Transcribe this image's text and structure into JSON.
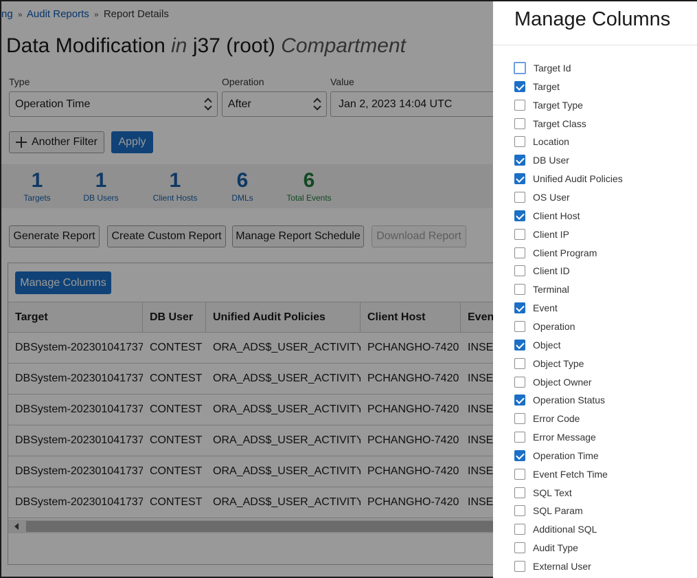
{
  "breadcrumb": {
    "items": [
      "ng",
      "Audit Reports",
      "Report Details"
    ],
    "separator": "»"
  },
  "title": {
    "main": "Data Modification",
    "in": "in",
    "compartment_name": "j37 (root)",
    "compartment_word": "Compartment"
  },
  "filters": {
    "type_label": "Type",
    "type_value": "Operation Time",
    "operation_label": "Operation",
    "operation_value": "After",
    "value_label": "Value",
    "value_value": "Jan 2, 2023 14:04 UTC",
    "another_filter_label": "Another Filter",
    "apply_label": "Apply"
  },
  "summary": [
    {
      "value": "1",
      "label": "Targets"
    },
    {
      "value": "1",
      "label": "DB Users"
    },
    {
      "value": "1",
      "label": "Client Hosts"
    },
    {
      "value": "6",
      "label": "DMLs"
    },
    {
      "value": "6",
      "label": "Total Events"
    }
  ],
  "actions": {
    "generate_report": "Generate Report",
    "create_custom_report": "Create Custom Report",
    "manage_report_schedule": "Manage Report Schedule",
    "download_report": "Download Report"
  },
  "table": {
    "manage_columns_label": "Manage Columns",
    "headers": [
      "Target",
      "DB User",
      "Unified Audit Policies",
      "Client Host",
      "Event"
    ],
    "rows": [
      [
        "DBSystem-202301041737",
        "CONTEST",
        "ORA_ADS$_USER_ACTIVITY",
        "PCHANGHO-7420",
        "INSERT"
      ],
      [
        "DBSystem-202301041737",
        "CONTEST",
        "ORA_ADS$_USER_ACTIVITY",
        "PCHANGHO-7420",
        "INSERT"
      ],
      [
        "DBSystem-202301041737",
        "CONTEST",
        "ORA_ADS$_USER_ACTIVITY",
        "PCHANGHO-7420",
        "INSERT"
      ],
      [
        "DBSystem-202301041737",
        "CONTEST",
        "ORA_ADS$_USER_ACTIVITY",
        "PCHANGHO-7420",
        "INSERT"
      ],
      [
        "DBSystem-202301041737",
        "CONTEST",
        "ORA_ADS$_USER_ACTIVITY",
        "PCHANGHO-7420",
        "INSERT"
      ],
      [
        "DBSystem-202301041737",
        "CONTEST",
        "ORA_ADS$_USER_ACTIVITY",
        "PCHANGHO-7420",
        "INSERT"
      ]
    ]
  },
  "drawer": {
    "title": "Manage Columns",
    "columns": [
      {
        "label": "Target Id",
        "checked": false,
        "focused": true
      },
      {
        "label": "Target",
        "checked": true
      },
      {
        "label": "Target Type",
        "checked": false
      },
      {
        "label": "Target Class",
        "checked": false
      },
      {
        "label": "Location",
        "checked": false
      },
      {
        "label": "DB User",
        "checked": true
      },
      {
        "label": "Unified Audit Policies",
        "checked": true
      },
      {
        "label": "OS User",
        "checked": false
      },
      {
        "label": "Client Host",
        "checked": true
      },
      {
        "label": "Client IP",
        "checked": false
      },
      {
        "label": "Client Program",
        "checked": false
      },
      {
        "label": "Client ID",
        "checked": false
      },
      {
        "label": "Terminal",
        "checked": false
      },
      {
        "label": "Event",
        "checked": true
      },
      {
        "label": "Operation",
        "checked": false
      },
      {
        "label": "Object",
        "checked": true
      },
      {
        "label": "Object Type",
        "checked": false
      },
      {
        "label": "Object Owner",
        "checked": false
      },
      {
        "label": "Operation Status",
        "checked": true
      },
      {
        "label": "Error Code",
        "checked": false
      },
      {
        "label": "Error Message",
        "checked": false
      },
      {
        "label": "Operation Time",
        "checked": true
      },
      {
        "label": "Event Fetch Time",
        "checked": false
      },
      {
        "label": "SQL Text",
        "checked": false
      },
      {
        "label": "SQL Param",
        "checked": false
      },
      {
        "label": "Additional SQL",
        "checked": false
      },
      {
        "label": "Audit Type",
        "checked": false
      },
      {
        "label": "External User",
        "checked": false
      }
    ]
  },
  "colors": {
    "primary": "#1b6fc6",
    "stat_blue": "#1a5fa8",
    "stat_green": "#1e7a3a"
  }
}
